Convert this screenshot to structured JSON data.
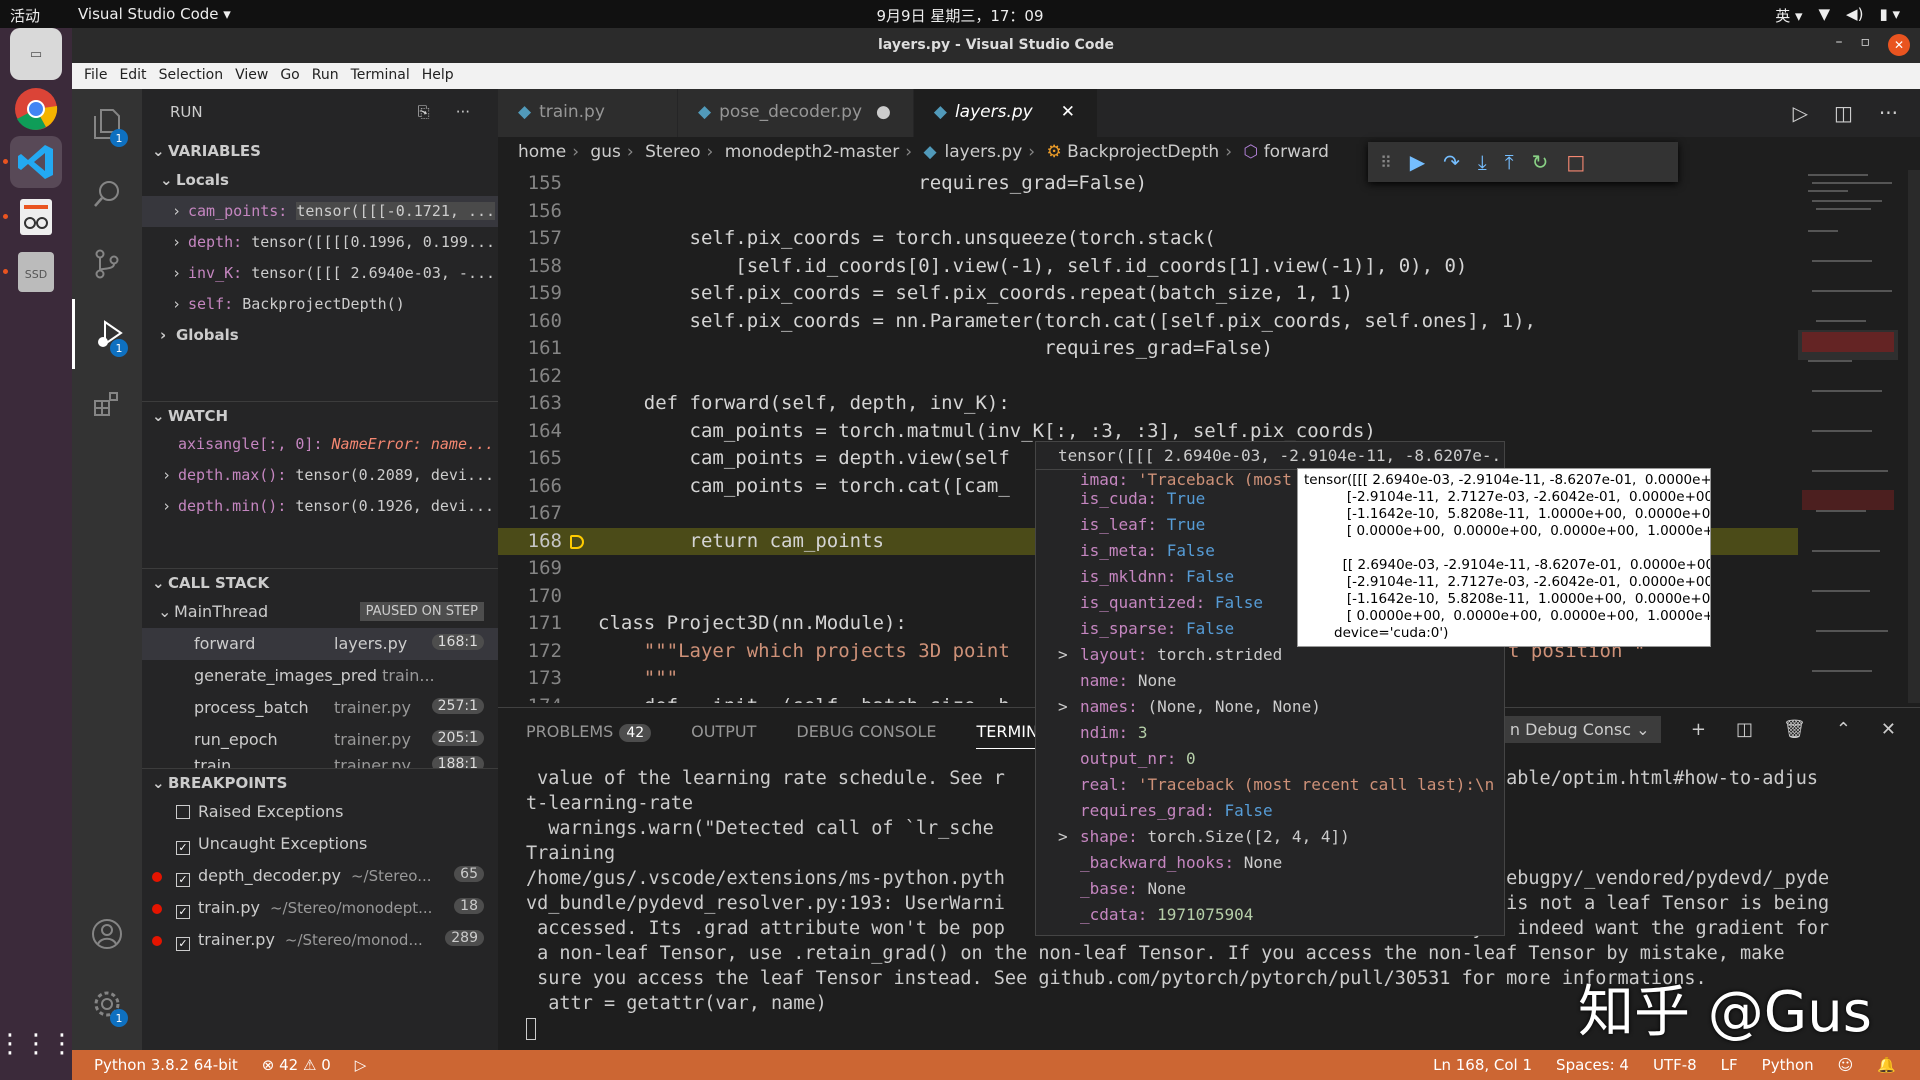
{
  "topbar": {
    "activities": "活动",
    "app": "Visual Studio Code ▾",
    "clock": "9月9日 星期三，17：09",
    "ime": "英 ▾"
  },
  "window": {
    "title": "layers.py - Visual Studio Code"
  },
  "menu": [
    "File",
    "Edit",
    "Selection",
    "View",
    "Go",
    "Run",
    "Terminal",
    "Help"
  ],
  "activity": {
    "explorer_badge": "1",
    "debug_badge": "1",
    "settings_badge": "1"
  },
  "sidebar": {
    "title": "RUN",
    "variables_header": "VARIABLES",
    "locals_label": "Locals",
    "locals": [
      {
        "name": "cam_points:",
        "value": "tensor([[[-0.1721, ..."
      },
      {
        "name": "depth:",
        "value": "tensor([[[[0.1996, 0.199..."
      },
      {
        "name": "inv_K:",
        "value": "tensor([[[ 2.6940e-03, -..."
      },
      {
        "name": "self:",
        "value": "BackprojectDepth()"
      }
    ],
    "globals_label": "Globals",
    "watch_header": "WATCH",
    "watch": [
      {
        "name": "axisangle[:, 0]:",
        "value": "NameError: name..."
      },
      {
        "name": "depth.max():",
        "value": "tensor(0.2089, devi..."
      },
      {
        "name": "depth.min():",
        "value": "tensor(0.1926, devi..."
      }
    ],
    "callstack_header": "CALL STACK",
    "thread": "MainThread",
    "paused": "PAUSED ON STEP",
    "frames": [
      {
        "fn": "forward",
        "file": "layers.py",
        "line": "168:1"
      },
      {
        "fn": "generate_images_pred",
        "file": "train...",
        "line": ""
      },
      {
        "fn": "process_batch",
        "file": "trainer.py",
        "line": "257:1"
      },
      {
        "fn": "run_epoch",
        "file": "trainer.py",
        "line": "205:1"
      },
      {
        "fn": "train",
        "file": "trainer.py",
        "line": "188:1"
      }
    ],
    "breakpoints_header": "BREAKPOINTS",
    "breakpoints": [
      {
        "label": "Raised Exceptions",
        "checked": false,
        "path": "",
        "count": ""
      },
      {
        "label": "Uncaught Exceptions",
        "checked": true,
        "path": "",
        "count": ""
      },
      {
        "label": "depth_decoder.py",
        "checked": true,
        "path": "~/Stereo...",
        "count": "65"
      },
      {
        "label": "train.py",
        "checked": true,
        "path": "~/Stereo/monodept...",
        "count": "18"
      },
      {
        "label": "trainer.py",
        "checked": true,
        "path": "~/Stereo/monod...",
        "count": "289"
      }
    ]
  },
  "tabs": [
    {
      "label": "train.py",
      "modified": false
    },
    {
      "label": "pose_decoder.py",
      "modified": true
    },
    {
      "label": "layers.py",
      "modified": false
    }
  ],
  "breadcrumb": [
    "home",
    "gus",
    "Stereo",
    "monodepth2-master",
    "layers.py",
    "BackprojectDepth",
    "forward"
  ],
  "code": [
    {
      "n": "155",
      "t": "                            requires_grad=False)"
    },
    {
      "n": "156",
      "t": ""
    },
    {
      "n": "157",
      "t": "        self.pix_coords = torch.unsqueeze(torch.stack("
    },
    {
      "n": "158",
      "t": "            [self.id_coords[0].view(-1), self.id_coords[1].view(-1)], 0), 0)"
    },
    {
      "n": "159",
      "t": "        self.pix_coords = self.pix_coords.repeat(batch_size, 1, 1)"
    },
    {
      "n": "160",
      "t": "        self.pix_coords = nn.Parameter(torch.cat([self.pix_coords, self.ones], 1),"
    },
    {
      "n": "161",
      "t": "                                       requires_grad=False)"
    },
    {
      "n": "162",
      "t": ""
    },
    {
      "n": "163",
      "t": "    def forward(self, depth, inv_K):"
    },
    {
      "n": "164",
      "t": "        cam_points = torch.matmul(inv_K[:, :3, :3], self.pix_coords)"
    },
    {
      "n": "165",
      "t": "        cam_points = depth.view(self"
    },
    {
      "n": "166",
      "t": "        cam_points = torch.cat([cam_"
    },
    {
      "n": "167",
      "t": ""
    },
    {
      "n": "168",
      "t": "        return cam_points"
    },
    {
      "n": "169",
      "t": ""
    },
    {
      "n": "170",
      "t": ""
    },
    {
      "n": "171",
      "t": "class Project3D(nn.Module):"
    },
    {
      "n": "172",
      "t": "    \"\"\"Layer which projects 3D point"
    },
    {
      "n": "173",
      "t": "    \"\"\""
    },
    {
      "n": "174",
      "t": "    def __init__(self, batch_size, h"
    }
  ],
  "code_tail": {
    "line172": "t position \""
  },
  "hover": {
    "header": "tensor([[[ 2.6940e-03, -2.9104e-11, -8.6207e-...",
    "rows": [
      {
        "c": "",
        "k": "imag:",
        "v": "'Traceback (most",
        "t": "s"
      },
      {
        "c": "",
        "k": "is_cuda:",
        "v": "True",
        "t": "b"
      },
      {
        "c": "",
        "k": "is_leaf:",
        "v": "True",
        "t": "b"
      },
      {
        "c": "",
        "k": "is_meta:",
        "v": "False",
        "t": "b"
      },
      {
        "c": "",
        "k": "is_mkldnn:",
        "v": "False",
        "t": "b"
      },
      {
        "c": "",
        "k": "is_quantized:",
        "v": "False",
        "t": "b"
      },
      {
        "c": "",
        "k": "is_sparse:",
        "v": "False",
        "t": "b"
      },
      {
        "c": ">",
        "k": "layout:",
        "v": "torch.strided",
        "t": ""
      },
      {
        "c": "",
        "k": "name:",
        "v": "None",
        "t": ""
      },
      {
        "c": ">",
        "k": "names:",
        "v": "(None, None, None)",
        "t": ""
      },
      {
        "c": "",
        "k": "ndim:",
        "v": "3",
        "t": "n"
      },
      {
        "c": "",
        "k": "output_nr:",
        "v": "0",
        "t": "n"
      },
      {
        "c": "",
        "k": "real:",
        "v": "'Traceback (most recent call last):\\n",
        "t": "s"
      },
      {
        "c": "",
        "k": "requires_grad:",
        "v": "False",
        "t": "b"
      },
      {
        "c": ">",
        "k": "shape:",
        "v": "torch.Size([2, 4, 4])",
        "t": ""
      },
      {
        "c": "",
        "k": "_backward_hooks:",
        "v": "None",
        "t": ""
      },
      {
        "c": "",
        "k": "_base:",
        "v": "None",
        "t": ""
      },
      {
        "c": "",
        "k": "_cdata:",
        "v": "1971075904",
        "t": "n"
      }
    ]
  },
  "tooltip": "tensor([[[ 2.6940e-03, -2.9104e-11, -8.6207e-01,  0.0000e+00],\n          [-2.9104e-11,  2.7127e-03, -2.6042e-01,  0.0000e+00],\n          [-1.1642e-10,  5.8208e-11,  1.0000e+00,  0.0000e+00],\n          [ 0.0000e+00,  0.0000e+00,  0.0000e+00,  1.0000e+00]],\n\n         [[ 2.6940e-03, -2.9104e-11, -8.6207e-01,  0.0000e+00],\n          [-2.9104e-11,  2.7127e-03, -2.6042e-01,  0.0000e+00],\n          [-1.1642e-10,  5.8208e-11,  1.0000e+00,  0.0000e+00],\n          [ 0.0000e+00,  0.0000e+00,  0.0000e+00,  1.0000e+00]]],\n       device='cuda:0')",
  "panel": {
    "tabs": [
      "PROBLEMS",
      "OUTPUT",
      "DEBUG CONSOLE",
      "TERMINAL"
    ],
    "problems_count": "42",
    "terminal_select": "n Debug Consc",
    "terminal": " value of the learning rate schedule. See r                                         s/stable/optim.html#how-to-adjus\nt-learning-rate\n  warnings.warn(\"Detected call of `lr_sche                                          . \"\nTraining\n/home/gus/.vscode/extensions/ms-python.pyth                                          n/debugpy/_vendored/pydevd/_pyde\nvd_bundle/pydevd_resolver.py:193: UserWarni                                          at is not a leaf Tensor is being\n accessed. Its .grad attribute won't be pop                                          you indeed want the gradient for\n a non-leaf Tensor, use .retain_grad() on the non-leaf Tensor. If you access the non-leaf Tensor by mistake, make\n sure you access the leaf Tensor instead. See github.com/pytorch/pytorch/pull/30531 for more informations.\n  attr = getattr(var, name)"
  },
  "watermark": "知乎 @Gus",
  "status": {
    "python": "Python 3.8.2 64-bit",
    "errors": "42",
    "warnings": "0",
    "position": "Ln 168, Col 1",
    "spaces": "Spaces: 4",
    "encoding": "UTF-8",
    "eol": "LF",
    "language": "Python"
  },
  "colors": {
    "statusbar": "#cc6633",
    "current_line": "#4b4b18",
    "accent": "#0e70c0"
  }
}
